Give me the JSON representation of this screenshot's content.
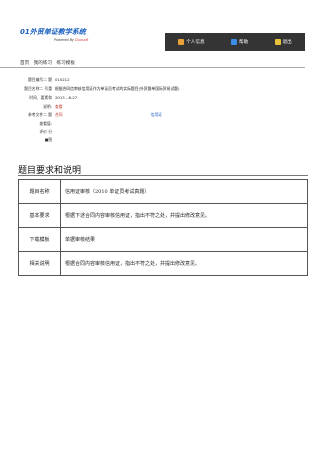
{
  "header": {
    "brand_num": "01",
    "brand_text": "外贸单证教学系统",
    "powered_prefix": "Powered By",
    "powered_company": "Duosoft",
    "toolbar": [
      {
        "label": "个人信息",
        "icon": "user-icon",
        "color": "#e8a23a"
      },
      {
        "label": "帮助",
        "icon": "help-icon",
        "color": "#3a8de8"
      },
      {
        "label": "退出",
        "icon": "exit-icon",
        "color": "#e8c23a"
      }
    ]
  },
  "nav": {
    "items": [
      "首页",
      "我的练习",
      "练习模板"
    ]
  },
  "meta": {
    "f1_label": "题目编号二 题",
    "f1_value": "010212",
    "f2_label": "题目名称二 号重",
    "f2_value": "根据合同信审核信用证作为单证员考试的实际题目(外贸跟单国际贸易试题)",
    "f3_label": "时间、要素和",
    "f3_value": "2013 --6-27",
    "f4_label": "说明:",
    "f4_value": "查看",
    "f5_label": "参考文件二 题",
    "f5_value": "合同",
    "f5_value2": "信用证",
    "f6_label": "查看值:",
    "f7_label": "评价 分",
    "f8_label": "■图"
  },
  "section": {
    "title": "题目要求和说明"
  },
  "table": [
    {
      "key": "题目名称",
      "value": "信用证审核（2010 单证员考试真题）"
    },
    {
      "key": "基本要求",
      "value": "根据下述合同内容审核信用证，指出不符之处，并提出修改意见。"
    },
    {
      "key": "下载模板",
      "value": "单据审核结果"
    },
    {
      "key": "相关说明",
      "value": "根据合同内容审核信用证，指出不符之处，并提出修改意见。"
    }
  ]
}
